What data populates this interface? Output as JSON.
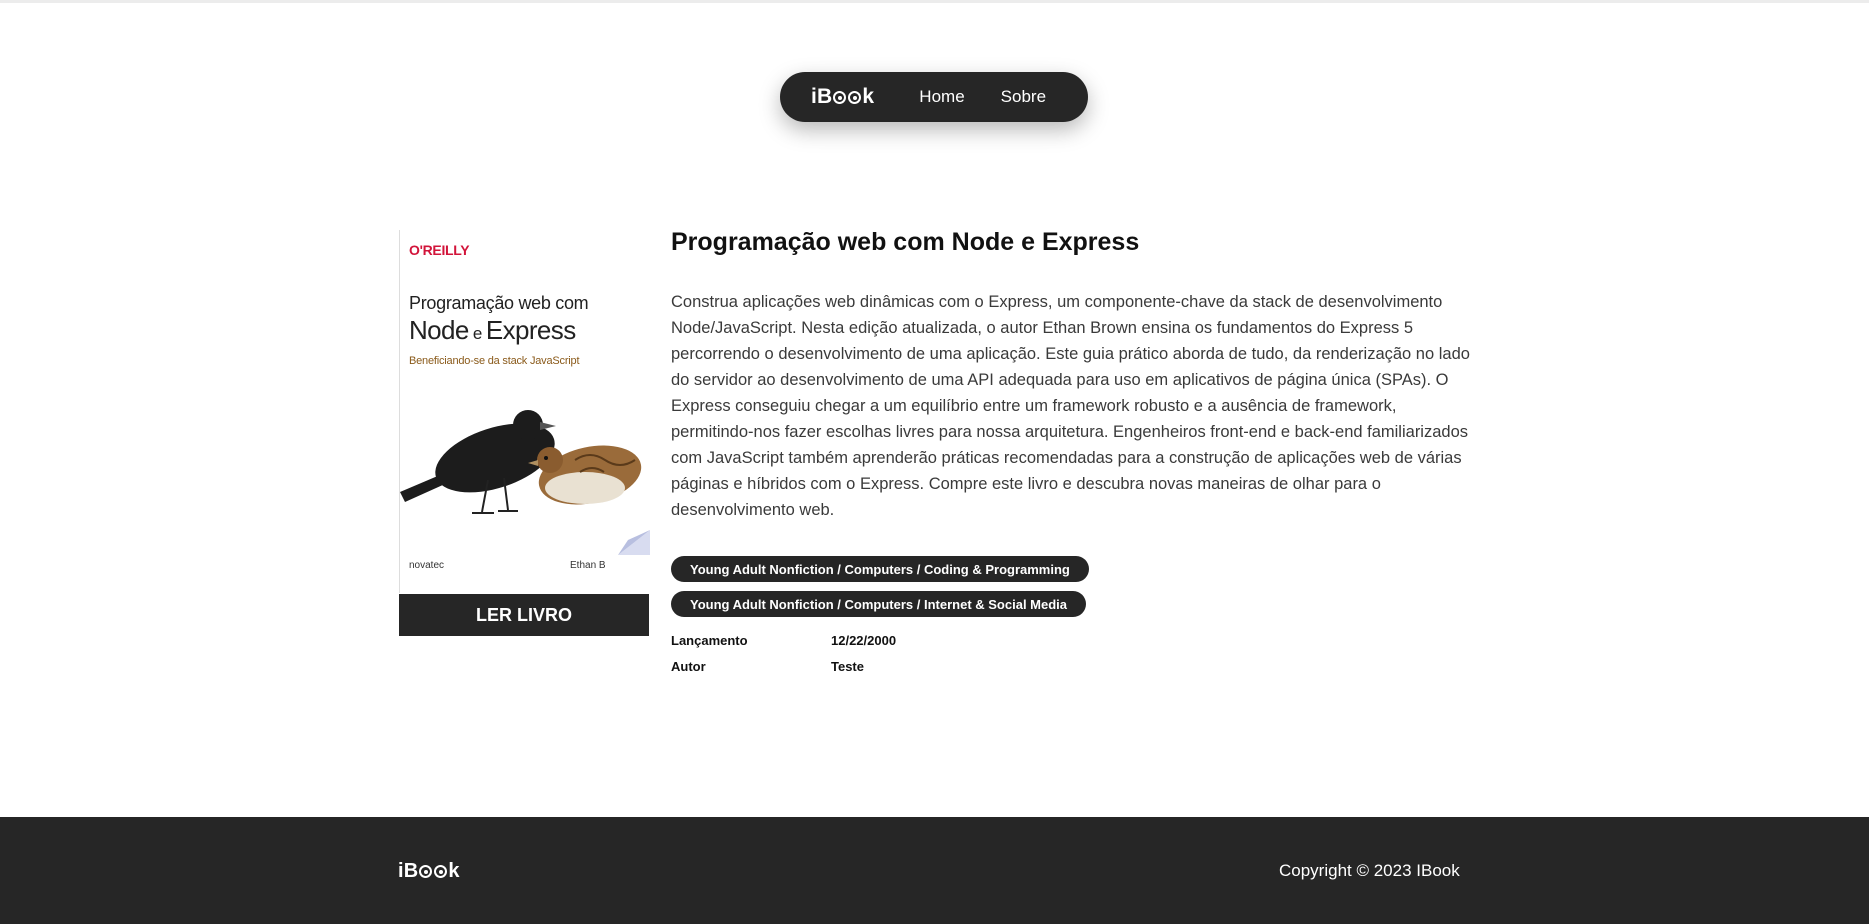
{
  "nav": {
    "logo": {
      "prefix": "iB",
      "suffix": "k"
    },
    "items": [
      {
        "label": "Home"
      },
      {
        "label": "Sobre"
      }
    ]
  },
  "book": {
    "cover": {
      "publisher": "O'REILLY",
      "title_line1": "Programação web com",
      "title_line2a": "Node",
      "title_line2b": " e ",
      "title_line2c": "Express",
      "subtitle": "Beneficiando-se da stack JavaScript",
      "imprint": "novatec",
      "author_short": "Ethan B"
    },
    "read_label": "LER LIVRO",
    "title": "Programação web com Node e Express",
    "description": "Construa aplicações web dinâmicas com o Express, um componente-chave da stack de desenvolvimento Node/JavaScript. Nesta edição atualizada, o autor Ethan Brown ensina os fundamentos do Express 5 percorrendo o desenvolvimento de uma aplicação. Este guia prático aborda de tudo, da renderização no lado do servidor ao desenvolvimento de uma API adequada para uso em aplicativos de página única (SPAs). O Express conseguiu chegar a um equilíbrio entre um framework robusto e a ausência de framework, permitindo-nos fazer escolhas livres para nossa arquitetura. Engenheiros front-end e back-end familiarizados com JavaScript também aprenderão práticas recomendadas para a construção de aplicações web de várias páginas e híbridos com o Express. Compre este livro e descubra novas maneiras de olhar para o desenvolvimento web.",
    "categories": [
      "Young Adult Nonfiction / Computers / Coding & Programming",
      "Young Adult Nonfiction / Computers / Internet & Social Media"
    ],
    "meta": [
      {
        "label": "Lançamento",
        "value": "12/22/2000"
      },
      {
        "label": "Autor",
        "value": "Teste"
      }
    ]
  },
  "footer": {
    "logo": {
      "prefix": "iB",
      "suffix": "k"
    },
    "copyright": "Copyright © 2023 IBook"
  },
  "colors": {
    "dark": "#262626",
    "publisher_red": "#d2143a",
    "background": "#ffffff"
  }
}
